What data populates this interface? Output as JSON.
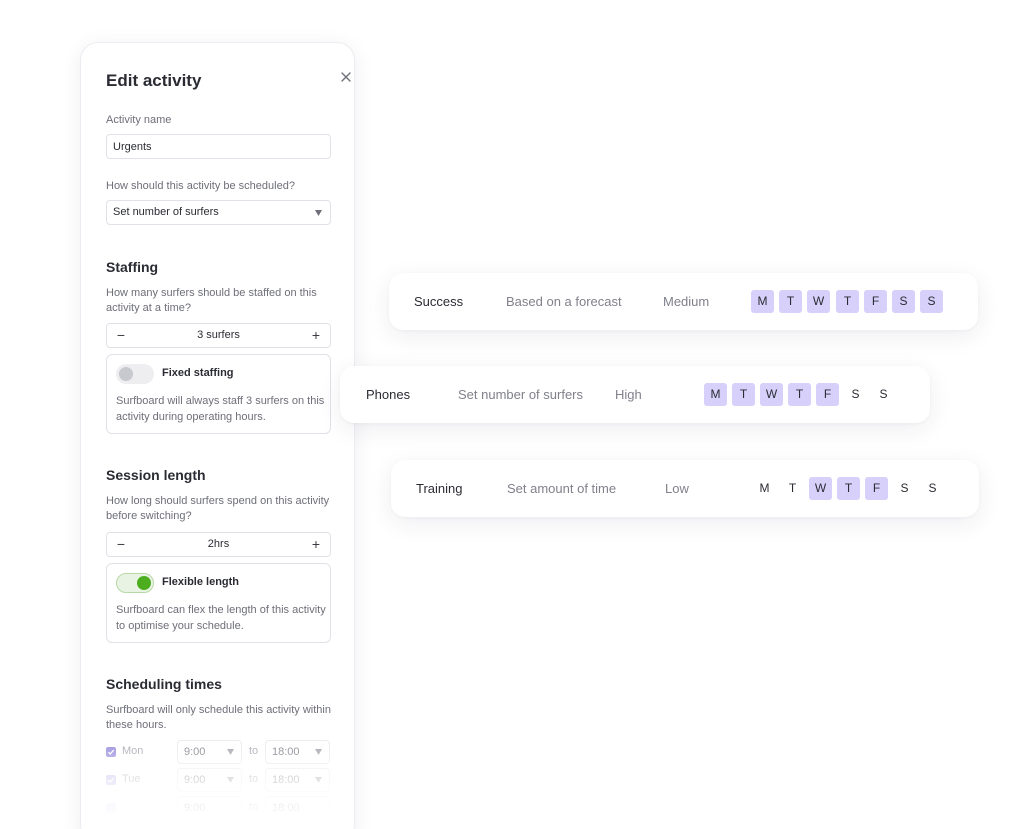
{
  "panel": {
    "title": "Edit activity",
    "activity_name_label": "Activity name",
    "activity_name_value": "Urgents",
    "schedule_question": "How should this activity be scheduled?",
    "schedule_value": "Set number of surfers",
    "staffing": {
      "heading": "Staffing",
      "question": "How many surfers should be staffed on this activity at a time?",
      "minus": "−",
      "plus": "+",
      "value": "3 surfers",
      "option_title": "Fixed staffing",
      "option_desc": "Surfboard will always staff 3 surfers on this activity during operating hours.",
      "option_enabled": false
    },
    "session": {
      "heading": "Session length",
      "question": "How long should surfers spend on this activity before switching?",
      "minus": "−",
      "plus": "+",
      "value": "2hrs",
      "option_title": "Flexible length",
      "option_desc": "Surfboard can flex the length of this activity to optimise your schedule.",
      "option_enabled": true
    },
    "scheduling": {
      "heading": "Scheduling times",
      "desc": "Surfboard will only schedule this activity within these hours.",
      "to_label": "to",
      "rows": [
        {
          "day": "Mon",
          "from": "9:00",
          "to": "18:00"
        },
        {
          "day": "Tue",
          "from": "9:00",
          "to": "18:00"
        },
        {
          "day": "",
          "from": "9:00",
          "to": "18:00"
        }
      ]
    }
  },
  "cards": [
    {
      "name": "Success",
      "mode": "Based on a forecast",
      "priority": "Medium",
      "days": [
        {
          "label": "M",
          "active": true
        },
        {
          "label": "T",
          "active": true
        },
        {
          "label": "W",
          "active": true
        },
        {
          "label": "T",
          "active": true
        },
        {
          "label": "F",
          "active": true
        },
        {
          "label": "S",
          "active": true
        },
        {
          "label": "S",
          "active": true
        }
      ]
    },
    {
      "name": "Phones",
      "mode": "Set number of surfers",
      "priority": "High",
      "days": [
        {
          "label": "M",
          "active": true
        },
        {
          "label": "T",
          "active": true
        },
        {
          "label": "W",
          "active": true
        },
        {
          "label": "T",
          "active": true
        },
        {
          "label": "F",
          "active": true
        },
        {
          "label": "S",
          "active": false
        },
        {
          "label": "S",
          "active": false
        }
      ]
    },
    {
      "name": "Training",
      "mode": "Set amount of time",
      "priority": "Low",
      "days": [
        {
          "label": "M",
          "active": false
        },
        {
          "label": "T",
          "active": false
        },
        {
          "label": "W",
          "active": true
        },
        {
          "label": "T",
          "active": true
        },
        {
          "label": "F",
          "active": true
        },
        {
          "label": "S",
          "active": false
        },
        {
          "label": "S",
          "active": false
        }
      ]
    }
  ],
  "colors": {
    "day_active": "#d6d0fb",
    "toggle_on": "#4cae1e",
    "checkbox": "#8b80d8"
  }
}
